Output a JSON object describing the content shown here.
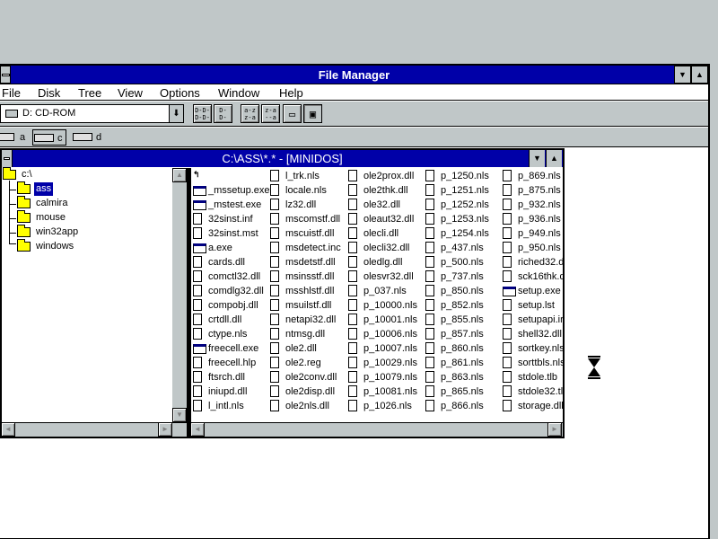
{
  "window": {
    "title": "File Manager",
    "minimize_glyph": "▼",
    "maximize_glyph": "▲"
  },
  "menu": [
    "File",
    "Disk",
    "Tree",
    "View",
    "Options",
    "Window",
    "Help"
  ],
  "toolbar": {
    "drive_combo_value": "D: CD-ROM",
    "combo_arrow": "⬇",
    "buttons": [
      {
        "name": "tree-view-button",
        "glyph": "D-D-\nD-D-"
      },
      {
        "name": "tree-dir-button",
        "glyph": "D-\nD-"
      },
      {
        "name": "sort-by-name-button",
        "glyph": "a-z\nz-a"
      },
      {
        "name": "sort-by-type-button",
        "glyph": "z-a\n--a"
      },
      {
        "name": "new-window-button",
        "glyph": "▭"
      },
      {
        "name": "properties-button",
        "glyph": "▣"
      }
    ]
  },
  "drives": [
    {
      "letter": "a",
      "type": "floppy",
      "active": false
    },
    {
      "letter": "c",
      "type": "hard-disk",
      "active": true
    },
    {
      "letter": "d",
      "type": "cd-rom",
      "active": false
    }
  ],
  "child_window": {
    "title": "C:\\ASS\\*.* - [MINIDOS]",
    "minimize_glyph": "▼",
    "maximize_glyph": "▲"
  },
  "tree": [
    {
      "label": "c:\\",
      "level": 0,
      "selected": false
    },
    {
      "label": "ass",
      "level": 1,
      "selected": true
    },
    {
      "label": "calmira",
      "level": 1,
      "selected": false
    },
    {
      "label": "mouse",
      "level": 1,
      "selected": false
    },
    {
      "label": "win32app",
      "level": 1,
      "selected": false
    },
    {
      "label": "windows",
      "level": 1,
      "selected": false
    }
  ],
  "scroll_glyphs": {
    "up": "▲",
    "down": "▼",
    "left": "◄",
    "right": "►"
  },
  "file_columns": [
    [
      {
        "name": "",
        "icon": "up"
      },
      {
        "name": "_mssetup.exe",
        "icon": "exe"
      },
      {
        "name": "_mstest.exe",
        "icon": "exe"
      },
      {
        "name": "32sinst.inf",
        "icon": "doc"
      },
      {
        "name": "32sinst.mst",
        "icon": "doc"
      },
      {
        "name": "a.exe",
        "icon": "exe"
      },
      {
        "name": "cards.dll",
        "icon": "doc"
      },
      {
        "name": "comctl32.dll",
        "icon": "doc"
      },
      {
        "name": "comdlg32.dll",
        "icon": "doc"
      },
      {
        "name": "compobj.dll",
        "icon": "doc"
      },
      {
        "name": "crtdll.dll",
        "icon": "doc"
      },
      {
        "name": "ctype.nls",
        "icon": "doc"
      },
      {
        "name": "freecell.exe",
        "icon": "exe"
      },
      {
        "name": "freecell.hlp",
        "icon": "doc"
      },
      {
        "name": "ftsrch.dll",
        "icon": "doc"
      },
      {
        "name": "iniupd.dll",
        "icon": "doc"
      },
      {
        "name": "l_intl.nls",
        "icon": "doc"
      }
    ],
    [
      {
        "name": "l_trk.nls",
        "icon": "doc"
      },
      {
        "name": "locale.nls",
        "icon": "doc"
      },
      {
        "name": "lz32.dll",
        "icon": "doc"
      },
      {
        "name": "mscomstf.dll",
        "icon": "doc"
      },
      {
        "name": "mscuistf.dll",
        "icon": "doc"
      },
      {
        "name": "msdetect.inc",
        "icon": "doc"
      },
      {
        "name": "msdetstf.dll",
        "icon": "doc"
      },
      {
        "name": "msinsstf.dll",
        "icon": "doc"
      },
      {
        "name": "msshlstf.dll",
        "icon": "doc"
      },
      {
        "name": "msuilstf.dll",
        "icon": "doc"
      },
      {
        "name": "netapi32.dll",
        "icon": "doc"
      },
      {
        "name": "ntmsg.dll",
        "icon": "doc"
      },
      {
        "name": "ole2.dll",
        "icon": "doc"
      },
      {
        "name": "ole2.reg",
        "icon": "doc"
      },
      {
        "name": "ole2conv.dll",
        "icon": "doc"
      },
      {
        "name": "ole2disp.dll",
        "icon": "doc"
      },
      {
        "name": "ole2nls.dll",
        "icon": "doc"
      }
    ],
    [
      {
        "name": "ole2prox.dll",
        "icon": "doc"
      },
      {
        "name": "ole2thk.dll",
        "icon": "doc"
      },
      {
        "name": "ole32.dll",
        "icon": "doc"
      },
      {
        "name": "oleaut32.dll",
        "icon": "doc"
      },
      {
        "name": "olecli.dll",
        "icon": "doc"
      },
      {
        "name": "olecli32.dll",
        "icon": "doc"
      },
      {
        "name": "oledlg.dll",
        "icon": "doc"
      },
      {
        "name": "olesvr32.dll",
        "icon": "doc"
      },
      {
        "name": "p_037.nls",
        "icon": "doc"
      },
      {
        "name": "p_10000.nls",
        "icon": "doc"
      },
      {
        "name": "p_10001.nls",
        "icon": "doc"
      },
      {
        "name": "p_10006.nls",
        "icon": "doc"
      },
      {
        "name": "p_10007.nls",
        "icon": "doc"
      },
      {
        "name": "p_10029.nls",
        "icon": "doc"
      },
      {
        "name": "p_10079.nls",
        "icon": "doc"
      },
      {
        "name": "p_10081.nls",
        "icon": "doc"
      },
      {
        "name": "p_1026.nls",
        "icon": "doc"
      }
    ],
    [
      {
        "name": "p_1250.nls",
        "icon": "doc"
      },
      {
        "name": "p_1251.nls",
        "icon": "doc"
      },
      {
        "name": "p_1252.nls",
        "icon": "doc"
      },
      {
        "name": "p_1253.nls",
        "icon": "doc"
      },
      {
        "name": "p_1254.nls",
        "icon": "doc"
      },
      {
        "name": "p_437.nls",
        "icon": "doc"
      },
      {
        "name": "p_500.nls",
        "icon": "doc"
      },
      {
        "name": "p_737.nls",
        "icon": "doc"
      },
      {
        "name": "p_850.nls",
        "icon": "doc"
      },
      {
        "name": "p_852.nls",
        "icon": "doc"
      },
      {
        "name": "p_855.nls",
        "icon": "doc"
      },
      {
        "name": "p_857.nls",
        "icon": "doc"
      },
      {
        "name": "p_860.nls",
        "icon": "doc"
      },
      {
        "name": "p_861.nls",
        "icon": "doc"
      },
      {
        "name": "p_863.nls",
        "icon": "doc"
      },
      {
        "name": "p_865.nls",
        "icon": "doc"
      },
      {
        "name": "p_866.nls",
        "icon": "doc"
      }
    ],
    [
      {
        "name": "p_869.nls",
        "icon": "doc"
      },
      {
        "name": "p_875.nls",
        "icon": "doc"
      },
      {
        "name": "p_932.nls",
        "icon": "doc"
      },
      {
        "name": "p_936.nls",
        "icon": "doc"
      },
      {
        "name": "p_949.nls",
        "icon": "doc"
      },
      {
        "name": "p_950.nls",
        "icon": "doc"
      },
      {
        "name": "riched32.d",
        "icon": "doc"
      },
      {
        "name": "sck16thk.d",
        "icon": "doc"
      },
      {
        "name": "setup.exe",
        "icon": "exe"
      },
      {
        "name": "setup.lst",
        "icon": "doc"
      },
      {
        "name": "setupapi.ir",
        "icon": "doc"
      },
      {
        "name": "shell32.dll",
        "icon": "doc"
      },
      {
        "name": "sortkey.nls",
        "icon": "doc"
      },
      {
        "name": "sorttbls.nls",
        "icon": "doc"
      },
      {
        "name": "stdole.tlb",
        "icon": "doc"
      },
      {
        "name": "stdole32.tl",
        "icon": "doc"
      },
      {
        "name": "storage.dll",
        "icon": "doc"
      }
    ]
  ],
  "icon_glyphs": {
    "up": "↰"
  }
}
